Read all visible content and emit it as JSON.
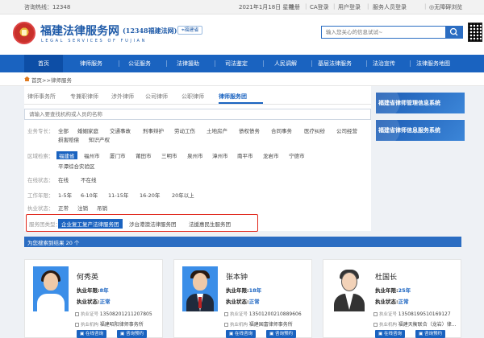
{
  "topbar": {
    "hotline": "咨询热线：12348",
    "date": "2021年1月18日 星期一",
    "links": [
      "注册",
      "CA登录",
      "用户登录",
      "服务人员登录",
      "无障碍浏览"
    ]
  },
  "header": {
    "site_title": "福建法律服务网",
    "site_subtitle": "(12348福建法网)",
    "site_en": "LEGAL SERVICES OF FUJIAN",
    "location": "福建省",
    "search_placeholder": "输入您关心的信息试试~"
  },
  "nav": {
    "items": [
      "首页",
      "律师服务",
      "公证服务",
      "法律援助",
      "司法鉴定",
      "人民调解",
      "基层法律服务",
      "法治宣传",
      "法律服务地图"
    ],
    "active": "首页"
  },
  "breadcrumb": {
    "home": "首页>>",
    "current": "律师服务"
  },
  "tabs": [
    "律师事务所",
    "专兼职律师",
    "涉外律师",
    "公司律师",
    "公职律师",
    "律师服务团"
  ],
  "active_tab": "律师服务团",
  "panel_search_placeholder": "请输入要查找机构或人员的名称",
  "filters": {
    "business": {
      "label": "业务专长：",
      "options": [
        "全部",
        "婚姻家庭",
        "交通事故",
        "刑事辩护",
        "劳动工伤",
        "土地房产",
        "债权债务",
        "合同事务",
        "医疗纠纷",
        "公司经营",
        "损害赔偿",
        "知识产权"
      ]
    },
    "region": {
      "label": "区域检索：",
      "options": [
        "福建省",
        "福州市",
        "厦门市",
        "莆田市",
        "三明市",
        "泉州市",
        "漳州市",
        "南平市",
        "龙岩市",
        "宁德市",
        "平潭综合实验区"
      ],
      "selected": "福建省"
    },
    "online": {
      "label": "在线状态：",
      "options": [
        "在线",
        "不在线"
      ]
    },
    "years": {
      "label": "工作年限：",
      "options": [
        "1-5年",
        "6-10年",
        "11-15年",
        "16-20年",
        "20年以上"
      ]
    },
    "status": {
      "label": "执业状态：",
      "options": [
        "正常",
        "注销",
        "吊销"
      ]
    },
    "group_type": {
      "label": "服务团类型：",
      "options": [
        "企业复工复产法律服务团",
        "涉台港澳法律服务团",
        "法援惠民生服务团"
      ],
      "selected": "企业复工复产法律服务团"
    }
  },
  "banners": [
    "福建省律师管理信息系统",
    "福建省律师信息服务系统"
  ],
  "results": {
    "text": "为您搜索到结果 20 个"
  },
  "lawyers": [
    {
      "name": "何秀英",
      "years_label": "执业年限:",
      "years": "8年",
      "status_label": "执业状态:",
      "status": "正常",
      "cert_label": "执业证号",
      "cert": "13508201211207805",
      "firm_label": "执业机构",
      "firm": "福建昭阳律师事务所",
      "btn_consult": "在线咨询",
      "btn_book": "咨询预约"
    },
    {
      "name": "张本钟",
      "years_label": "执业年限:",
      "years": "18年",
      "status_label": "执业状态:",
      "status": "正常",
      "cert_label": "执业证号",
      "cert": "13501200210889606",
      "firm_label": "执业机构",
      "firm": "福建国富律师事务所",
      "btn_consult": "在线咨询",
      "btn_book": "咨询预约"
    },
    {
      "name": "杜国长",
      "years_label": "执业年限:",
      "years": "25年",
      "status_label": "执业状态:",
      "status": "正常",
      "cert_label": "执业证号",
      "cert": "13508199510169127",
      "firm_label": "执业机构",
      "firm": "福建天衡联合（龙岩）律...",
      "btn_consult": "在线咨询",
      "btn_book": "咨询预约"
    }
  ],
  "colors": {
    "primary": "#1a63c0",
    "highlight_box": "#e0261a"
  }
}
